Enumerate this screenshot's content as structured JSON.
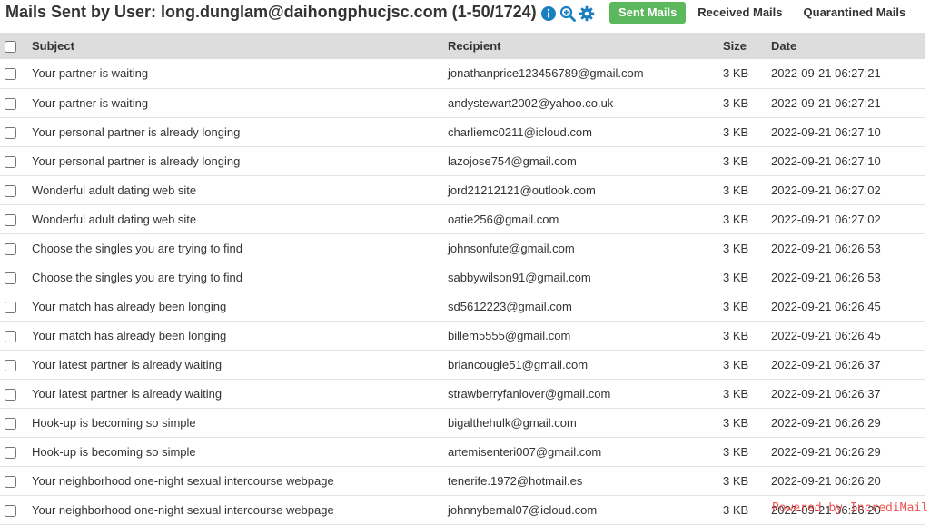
{
  "header": {
    "title": "Mails Sent by User: long.dunglam@daihongphucjsc.com (1-50/1724)",
    "icons": [
      "info-icon",
      "zoom-in-icon",
      "gear-icon"
    ],
    "tabs": [
      {
        "label": "Sent Mails",
        "active": true
      },
      {
        "label": "Received Mails",
        "active": false
      },
      {
        "label": "Quarantined Mails",
        "active": false
      }
    ],
    "accent_color": "#5cb85c",
    "icon_color": "#1a7fc1"
  },
  "table": {
    "columns": [
      "Subject",
      "Recipient",
      "Size",
      "Date"
    ],
    "rows": [
      {
        "subject": "Your partner is waiting",
        "recipient": "jonathanprice123456789@gmail.com",
        "size": "3 KB",
        "date": "2022-09-21 06:27:21"
      },
      {
        "subject": "Your partner is waiting",
        "recipient": "andystewart2002@yahoo.co.uk",
        "size": "3 KB",
        "date": "2022-09-21 06:27:21"
      },
      {
        "subject": "Your personal partner is already longing",
        "recipient": "charliemc0211@icloud.com",
        "size": "3 KB",
        "date": "2022-09-21 06:27:10"
      },
      {
        "subject": "Your personal partner is already longing",
        "recipient": "lazojose754@gmail.com",
        "size": "3 KB",
        "date": "2022-09-21 06:27:10"
      },
      {
        "subject": "Wonderful adult dating web site",
        "recipient": "jord21212121@outlook.com",
        "size": "3 KB",
        "date": "2022-09-21 06:27:02"
      },
      {
        "subject": "Wonderful adult dating web site",
        "recipient": "oatie256@gmail.com",
        "size": "3 KB",
        "date": "2022-09-21 06:27:02"
      },
      {
        "subject": "Choose the singles you are trying to find",
        "recipient": "johnsonfute@gmail.com",
        "size": "3 KB",
        "date": "2022-09-21 06:26:53"
      },
      {
        "subject": "Choose the singles you are trying to find",
        "recipient": "sabbywilson91@gmail.com",
        "size": "3 KB",
        "date": "2022-09-21 06:26:53"
      },
      {
        "subject": "Your match has already been longing",
        "recipient": "sd5612223@gmail.com",
        "size": "3 KB",
        "date": "2022-09-21 06:26:45"
      },
      {
        "subject": "Your match has already been longing",
        "recipient": "billem5555@gmail.com",
        "size": "3 KB",
        "date": "2022-09-21 06:26:45"
      },
      {
        "subject": "Your latest partner is already waiting",
        "recipient": "briancougle51@gmail.com",
        "size": "3 KB",
        "date": "2022-09-21 06:26:37"
      },
      {
        "subject": "Your latest partner is already waiting",
        "recipient": "strawberryfanlover@gmail.com",
        "size": "3 KB",
        "date": "2022-09-21 06:26:37"
      },
      {
        "subject": "Hook-up is becoming so simple",
        "recipient": "bigalthehulk@gmail.com",
        "size": "3 KB",
        "date": "2022-09-21 06:26:29"
      },
      {
        "subject": "Hook-up is becoming so simple",
        "recipient": "artemisenteri007@gmail.com",
        "size": "3 KB",
        "date": "2022-09-21 06:26:29"
      },
      {
        "subject": "Your neighborhood one-night sexual intercourse webpage",
        "recipient": "tenerife.1972@hotmail.es",
        "size": "3 KB",
        "date": "2022-09-21 06:26:20"
      },
      {
        "subject": "Your neighborhood one-night sexual intercourse webpage",
        "recipient": "johnnybernal07@icloud.com",
        "size": "3 KB",
        "date": "2022-09-21 06:26:20"
      }
    ]
  },
  "watermark": "Powered by IncrediMail"
}
